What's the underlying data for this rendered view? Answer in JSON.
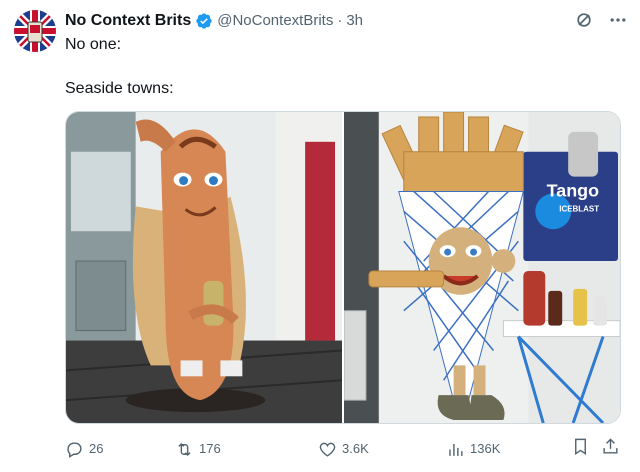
{
  "tweet": {
    "display_name": "No Context Brits",
    "handle": "@NoContextBrits",
    "separator": "·",
    "time": "3h",
    "text_line1": "No one:",
    "text_line2": "Seaside towns:"
  },
  "images": [
    {
      "name": "hotdog-statue-photo"
    },
    {
      "name": "chips-cone-statue-photo",
      "poster_brand": "Tango",
      "poster_sub": "ICEBLAST"
    }
  ],
  "actions": {
    "replies": "26",
    "retweets": "176",
    "likes": "3.6K",
    "views": "136K"
  },
  "icons": {
    "verified": "verified-badge-icon",
    "grok": "grok-icon",
    "more": "more-icon",
    "reply": "reply-icon",
    "retweet": "retweet-icon",
    "like": "heart-icon",
    "views": "views-icon",
    "bookmark": "bookmark-icon",
    "share": "share-icon"
  },
  "colors": {
    "verified_blue": "#1d9bf0",
    "text_primary": "#0f1419",
    "text_secondary": "#536471"
  }
}
